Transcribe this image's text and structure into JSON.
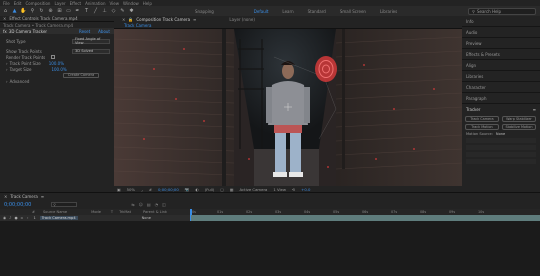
{
  "menubar": {
    "items": [
      "File",
      "Edit",
      "Composition",
      "Layer",
      "Effect",
      "Animation",
      "View",
      "Window",
      "Help"
    ]
  },
  "toolbar": {
    "snapping_label": "Snapping",
    "workspaces": [
      "Default",
      "Learn",
      "Standard",
      "Small Screen",
      "Libraries"
    ],
    "active_workspace": "Default",
    "search_placeholder": "Search Help"
  },
  "effect_controls": {
    "tab_label": "Effect Controls Track Camera.mp4",
    "breadcrumb": "Track Camera • Track Camera.mp4",
    "effect_name": "3D Camera Tracker",
    "reset_label": "Reset",
    "about_label": "About",
    "shot_type_label": "Shot Type",
    "shot_type_value": "Fixed Angle of View",
    "show_track_points_label": "Show Track Points",
    "show_track_points_value": "3D Solved",
    "render_track_points_label": "Render Track Points",
    "track_point_size_label": "Track Point Size",
    "track_point_size_value": "100.0%",
    "target_size_label": "Target Size",
    "target_size_value": "100.0%",
    "create_camera_label": "Create Camera",
    "advanced_label": "Advanced"
  },
  "viewer": {
    "comp_tab": "Composition Track Camera",
    "layer_tab": "Layer (none)",
    "subtab": "Track Camera",
    "zoom": "50%",
    "timecode": "0;00;00;00",
    "resolution": "(Full)",
    "camera": "Active Camera",
    "view": "1 View",
    "exposure": "+0.0"
  },
  "right_panel": {
    "items": [
      "Info",
      "Audio",
      "Preview",
      "Effects & Presets",
      "Align",
      "Libraries",
      "Character",
      "Paragraph"
    ],
    "tracker_title": "Tracker",
    "track_camera_label": "Track Camera",
    "warp_stabilizer_label": "Warp Stabilizer",
    "track_motion_label": "Track Motion",
    "stabilize_motion_label": "Stabilize Motion",
    "motion_source_label": "Motion Source:",
    "motion_source_value": "None"
  },
  "timeline": {
    "tab_label": "Track Camera",
    "timecode": "0;00;00;00",
    "search_placeholder": "",
    "columns": [
      "#",
      "Source Name",
      "Mode",
      "T",
      "TrkMat",
      "Parent & Link"
    ],
    "layers": [
      {
        "num": "1",
        "name": "Track Camera.mp4",
        "parent": "None"
      }
    ],
    "ruler_marks": [
      "0s",
      "01s",
      "02s",
      "03s",
      "04s",
      "05s",
      "06s",
      "07s",
      "08s",
      "09s",
      "10s"
    ]
  },
  "colors": {
    "accent": "#3a8ee6",
    "panel": "#232323",
    "track_bar": "#5f7d7d"
  }
}
